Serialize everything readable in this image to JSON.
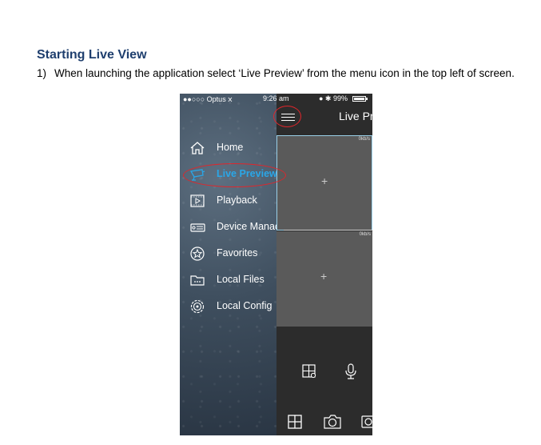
{
  "doc": {
    "heading": "Starting Live View",
    "step_number": "1)",
    "step_text": "When launching the application select ‘Live Preview’ from the menu icon in the top left of screen."
  },
  "phone": {
    "status": {
      "carrier": "●●○○○ Optus ᰞ",
      "time": "9:26 am",
      "battery": "● ✱ 99%"
    },
    "title": "Live Pr",
    "menu": [
      {
        "label": "Home",
        "icon": "home-icon"
      },
      {
        "label": "Live Preview",
        "icon": "camera-icon",
        "active": true
      },
      {
        "label": "Playback",
        "icon": "playback-icon"
      },
      {
        "label": "Device Manac",
        "icon": "device-icon"
      },
      {
        "label": "Favorites",
        "icon": "star-icon"
      },
      {
        "label": "Local Files",
        "icon": "folder-icon"
      },
      {
        "label": "Local Config",
        "icon": "gear-icon"
      }
    ],
    "cells": [
      {
        "rate": "0kb/s",
        "plus": "+"
      },
      {
        "rate": "0kb/s",
        "plus": "+"
      }
    ],
    "colors": {
      "accent": "#2aa7e8",
      "highlight_ellipse": "#e0262b",
      "heading": "#1f3f6e"
    }
  }
}
